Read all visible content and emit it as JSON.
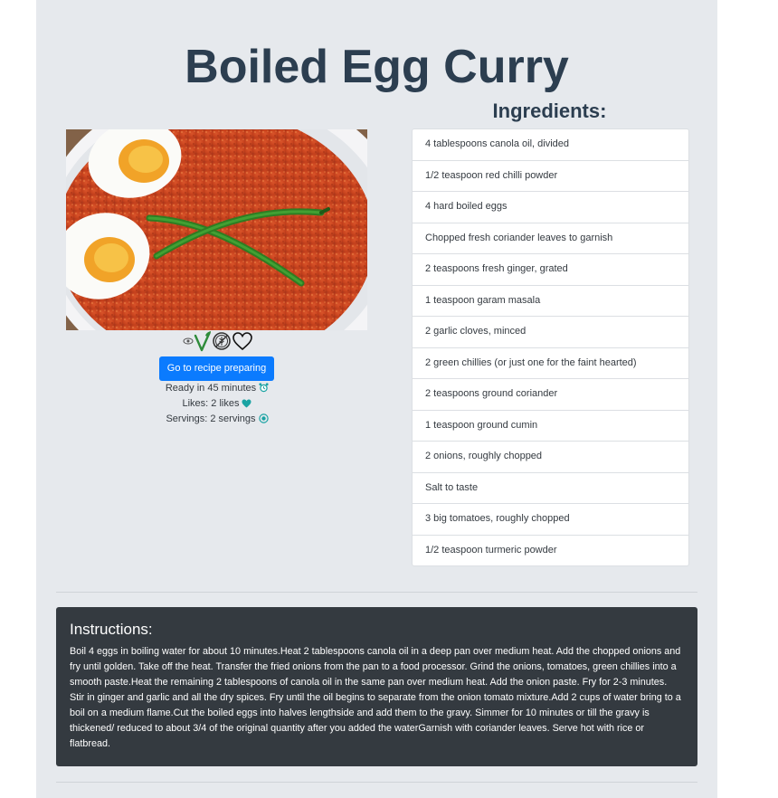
{
  "recipe": {
    "title": "Boiled Egg Curry",
    "image_alt": "Boiled egg curry with green chillies",
    "badges": [
      "eye-icon",
      "vegetarian-icon",
      "gluten-free-icon",
      "heart-outline-icon"
    ],
    "cta_label": "Go to recipe preparing",
    "ready_text": "Ready in 45 minutes",
    "likes_text": "Likes: 2 likes",
    "servings_text": "Servings: 2 servings"
  },
  "ingredients": {
    "heading": "Ingredients:",
    "items": [
      "4 tablespoons canola oil, divided",
      "1/2 teaspoon red chilli powder",
      "4 hard boiled eggs",
      "Chopped fresh coriander leaves to garnish",
      "2 teaspoons fresh ginger, grated",
      "1 teaspoon garam masala",
      "2 garlic cloves, minced",
      "2 green chillies (or just one for the faint hearted)",
      "2 teaspoons ground coriander",
      "1 teaspoon ground cumin",
      "2 onions, roughly chopped",
      "Salt to taste",
      "3 big tomatoes, roughly chopped",
      "1/2 teaspoon turmeric powder"
    ]
  },
  "instructions": {
    "heading": "Instructions:",
    "text": "Boil 4 eggs in boiling water for about 10 minutes.Heat 2 tablespoons canola oil in a deep pan over medium heat. Add the chopped onions and fry until golden. Take off the heat. Transfer the fried onions from the pan to a food processor. Grind the onions, tomatoes, green chillies into a smooth paste.Heat the remaining 2 tablespoons of canola oil in the same pan over medium heat. Add the onion paste. Fry for 2-3 minutes. Stir in ginger and garlic and all the dry spices. Fry until the oil begins to separate from the onion tomato mixture.Add 2 cups of water bring to a boil on a medium flame.Cut the boiled eggs into halves lengthside and add them to the gravy. Simmer for 10 minutes or till the gravy is thickened/ reduced to about 3/4 of the original quantity after you added the waterGarnish with coriander leaves. Serve hot with rice or flatbread."
  },
  "colors": {
    "page_bg": "#e6e9ed",
    "title": "#2c3e50",
    "button": "#0b7bfe",
    "instructions_bg": "#343a40",
    "accent_teal": "#1aa3a3"
  }
}
